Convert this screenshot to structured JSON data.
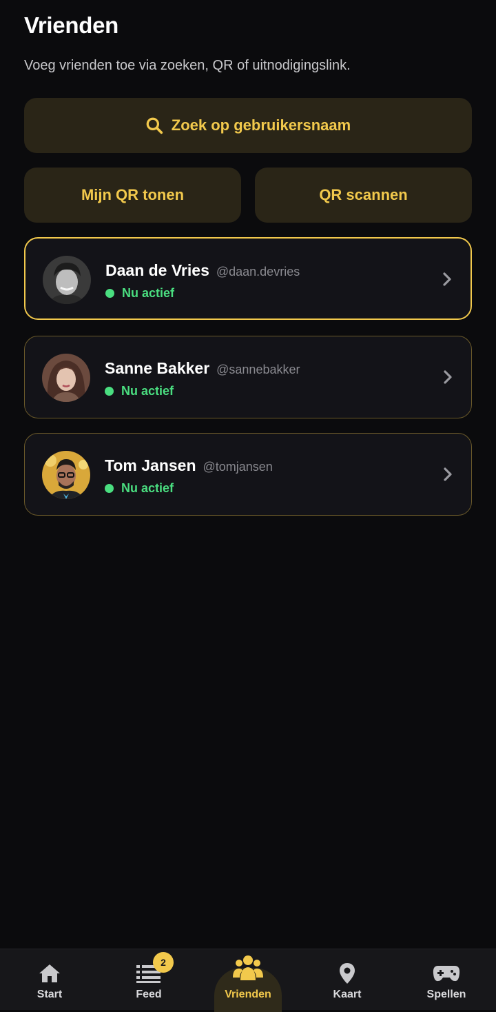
{
  "header": {
    "title": "Vrienden",
    "subtitle": "Voeg vrienden toe via zoeken, QR of uitnodigingslink."
  },
  "actions": {
    "search_label": "Zoek op gebruikersnaam",
    "qr_show_label": "Mijn QR tonen",
    "qr_scan_label": "QR scannen"
  },
  "friends": [
    {
      "name": "Daan de Vries",
      "handle": "@daan.devries",
      "status": "Nu actief",
      "avatar_icon": "avatar-photo"
    },
    {
      "name": "Sanne Bakker",
      "handle": "@sannebakker",
      "status": "Nu actief",
      "avatar_icon": "avatar-photo"
    },
    {
      "name": "Tom Jansen",
      "handle": "@tomjansen",
      "status": "Nu actief",
      "avatar_icon": "avatar-photo"
    }
  ],
  "nav": {
    "items": [
      {
        "label": "Start",
        "icon": "home-icon"
      },
      {
        "label": "Feed",
        "icon": "list-icon",
        "badge": "2"
      },
      {
        "label": "Vrienden",
        "icon": "users-icon",
        "active": true
      },
      {
        "label": "Kaart",
        "icon": "map-pin-icon"
      },
      {
        "label": "Spellen",
        "icon": "gamepad-icon"
      }
    ]
  },
  "colors": {
    "background": "#0b0b0d",
    "accent": "#f2c94c",
    "button_bg": "#2a2517",
    "card_bg": "#131318",
    "active_green": "#4ade80"
  }
}
